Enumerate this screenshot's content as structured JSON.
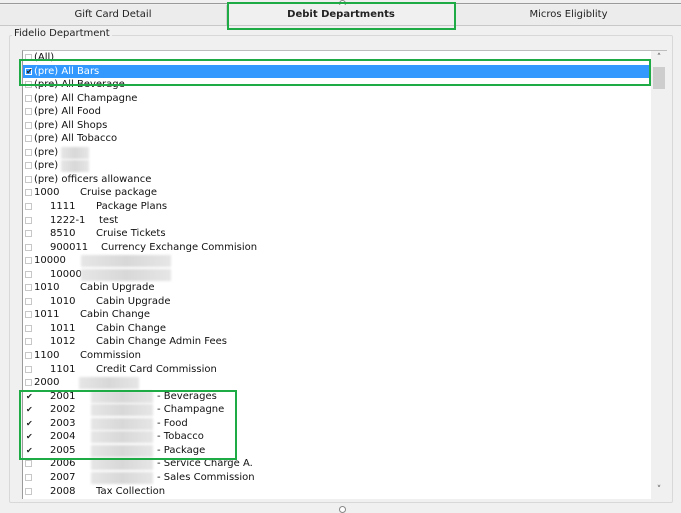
{
  "tabs": [
    {
      "label": "Gift Card Detail",
      "active": false
    },
    {
      "label": "Debit Departments",
      "active": true
    },
    {
      "label": "Micros Eligiblity",
      "active": false
    }
  ],
  "group_label": "Fidelio Department",
  "scrollbar": {
    "up_icon": "˄",
    "down_icon": "˅"
  },
  "check_mark": "✔",
  "rows": [
    {
      "level": 0,
      "code": "(All)",
      "name": "",
      "checked": false,
      "selected": false
    },
    {
      "level": 0,
      "code": "(pre) All Bars",
      "name": "",
      "checked": true,
      "selected": true
    },
    {
      "level": 0,
      "code": "(pre) All Beverage",
      "name": "",
      "checked": false,
      "selected": false
    },
    {
      "level": 0,
      "code": "(pre) All Champagne",
      "name": "",
      "checked": false,
      "selected": false
    },
    {
      "level": 0,
      "code": "(pre) All Food",
      "name": "",
      "checked": false,
      "selected": false
    },
    {
      "level": 0,
      "code": "(pre) All Shops",
      "name": "",
      "checked": false,
      "selected": false
    },
    {
      "level": 0,
      "code": "(pre) All Tobacco",
      "name": "",
      "checked": false,
      "selected": false
    },
    {
      "level": 0,
      "code": "(pre)",
      "name": "",
      "checked": false,
      "selected": false,
      "redacted": true
    },
    {
      "level": 0,
      "code": "(pre)",
      "name": "",
      "checked": false,
      "selected": false,
      "redacted": true
    },
    {
      "level": 0,
      "code": "(pre) officers allowance",
      "name": "",
      "checked": false,
      "selected": false
    },
    {
      "level": 0,
      "code": "1000",
      "name": "Cruise package",
      "checked": false,
      "selected": false
    },
    {
      "level": 1,
      "code": "1111",
      "name": "Package Plans",
      "checked": false,
      "selected": false
    },
    {
      "level": 1,
      "code": "1222-1",
      "name": "test",
      "checked": false,
      "selected": false
    },
    {
      "level": 1,
      "code": "8510",
      "name": "Cruise Tickets",
      "checked": false,
      "selected": false
    },
    {
      "level": 1,
      "code": "900011",
      "name": "Currency Exchange Commision",
      "checked": false,
      "selected": false
    },
    {
      "level": 0,
      "code": "10000",
      "name": "",
      "checked": false,
      "selected": false,
      "redacted": true
    },
    {
      "level": 1,
      "code": "10000",
      "name": "",
      "checked": false,
      "selected": false,
      "redacted": true
    },
    {
      "level": 0,
      "code": "1010",
      "name": "Cabin Upgrade",
      "checked": false,
      "selected": false
    },
    {
      "level": 1,
      "code": "1010",
      "name": "Cabin Upgrade",
      "checked": false,
      "selected": false
    },
    {
      "level": 0,
      "code": "1011",
      "name": "Cabin Change",
      "checked": false,
      "selected": false
    },
    {
      "level": 1,
      "code": "1011",
      "name": "Cabin Change",
      "checked": false,
      "selected": false
    },
    {
      "level": 1,
      "code": "1012",
      "name": "Cabin Change Admin Fees",
      "checked": false,
      "selected": false
    },
    {
      "level": 0,
      "code": "1100",
      "name": "Commission",
      "checked": false,
      "selected": false
    },
    {
      "level": 1,
      "code": "1101",
      "name": "Credit Card Commission",
      "checked": false,
      "selected": false
    },
    {
      "level": 0,
      "code": "2000",
      "name": "",
      "checked": false,
      "selected": false,
      "redacted": true
    },
    {
      "level": 1,
      "code": "2001",
      "name": "- Beverages",
      "checked": true,
      "selected": false,
      "redacted": true
    },
    {
      "level": 1,
      "code": "2002",
      "name": "- Champagne",
      "checked": true,
      "selected": false,
      "redacted": true
    },
    {
      "level": 1,
      "code": "2003",
      "name": "- Food",
      "checked": true,
      "selected": false,
      "redacted": true
    },
    {
      "level": 1,
      "code": "2004",
      "name": "- Tobacco",
      "checked": true,
      "selected": false,
      "redacted": true
    },
    {
      "level": 1,
      "code": "2005",
      "name": "- Package",
      "checked": true,
      "selected": false,
      "redacted": true
    },
    {
      "level": 1,
      "code": "2006",
      "name": "- Service Charge A.",
      "checked": false,
      "selected": false,
      "redacted": true
    },
    {
      "level": 1,
      "code": "2007",
      "name": "- Sales Commission",
      "checked": false,
      "selected": false,
      "redacted": true
    },
    {
      "level": 1,
      "code": "2008",
      "name": "Tax Collection",
      "checked": false,
      "selected": false
    }
  ]
}
